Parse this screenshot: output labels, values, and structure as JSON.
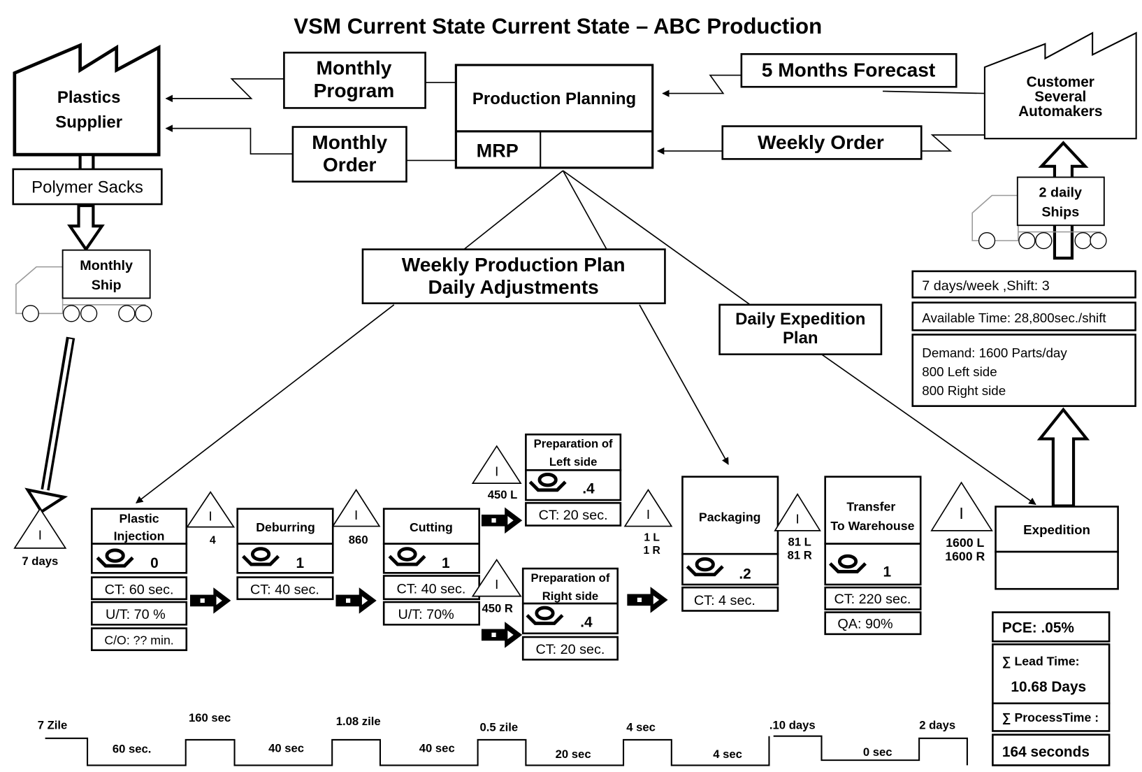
{
  "title": "VSM Current State Current State – ABC Production",
  "supplier": {
    "line1": "Plastics",
    "line2": "Supplier",
    "material": "Polymer  Sacks",
    "ship_line1": "Monthly",
    "ship_line2": "Ship",
    "inventory": "7 days"
  },
  "monthly_program": {
    "line1": "Monthly",
    "line2": "Program"
  },
  "monthly_order": {
    "line1": "Monthly",
    "line2": "Order"
  },
  "production_control": {
    "title": "Production Planning",
    "system": "MRP"
  },
  "forecast": "5 Months Forecast",
  "weekly_order": "Weekly Order",
  "customer": {
    "line1": "Customer",
    "line2": "Several",
    "line3": "Automakers",
    "ship_line1": "2 daily",
    "ship_line2": "Ships"
  },
  "customer_info": {
    "schedule": "7 days/week ,Shift: 3",
    "available_time": "Available Time: 28,800sec./shift",
    "demand": "Demand: 1600 Parts/day",
    "left": "800 Left side",
    "right": "800 Right side"
  },
  "weekly_plan": {
    "line1": "Weekly Production Plan",
    "line2": "Daily Adjustments"
  },
  "daily_expedition": {
    "line1": "Daily Expedition",
    "line2": "Plan"
  },
  "processes": {
    "injection": {
      "line1": "Plastic",
      "line2": "Injection",
      "operators": "0",
      "ct": "CT: 60 sec.",
      "ut": "U/T: 70 %",
      "co": "C/O: ?? min."
    },
    "deburring": {
      "name": "Deburring",
      "operators": "1",
      "ct": "CT: 40 sec."
    },
    "cutting": {
      "name": "Cutting",
      "operators": "1",
      "ct": "CT: 40 sec.",
      "ut": "U/T: 70%"
    },
    "prep_left": {
      "line1": "Preparation of",
      "line2": "Left side",
      "operators": ".4",
      "ct": "CT: 20 sec."
    },
    "prep_right": {
      "line1": "Preparation of",
      "line2": "Right side",
      "operators": ".4",
      "ct": "CT: 20 sec."
    },
    "packaging": {
      "name": "Packaging",
      "operators": ".2",
      "ct": "CT: 4 sec."
    },
    "transfer": {
      "line1": "Transfer",
      "line2": "To Warehouse",
      "operators": "1",
      "ct": "CT: 220 sec.",
      "qa": "QA: 90%"
    },
    "expedition": {
      "name": "Expedition"
    }
  },
  "inventory": {
    "symbol": "I",
    "after_injection": "4",
    "after_deburring": "860",
    "before_left": "450 L",
    "before_right": "450 R",
    "before_packaging": [
      "1 L",
      "1 R"
    ],
    "after_packaging": [
      "81 L",
      "81 R"
    ],
    "before_expedition": [
      "1600 L",
      "1600 R"
    ]
  },
  "summary": {
    "pce": "PCE: .05%",
    "lead_time_label": "∑ Lead Time:",
    "lead_time": "10.68 Days",
    "process_time_label": "∑ ProcessTime :",
    "process_time": "164 seconds"
  },
  "timeline": {
    "wait": [
      "7 Zile",
      "160 sec",
      "1.08 zile",
      "0.5 zile",
      "4 sec",
      ".10 days",
      "2 days"
    ],
    "process": [
      "60 sec.",
      "40 sec",
      "40 sec",
      "20 sec",
      "4 sec",
      "0 sec"
    ]
  }
}
